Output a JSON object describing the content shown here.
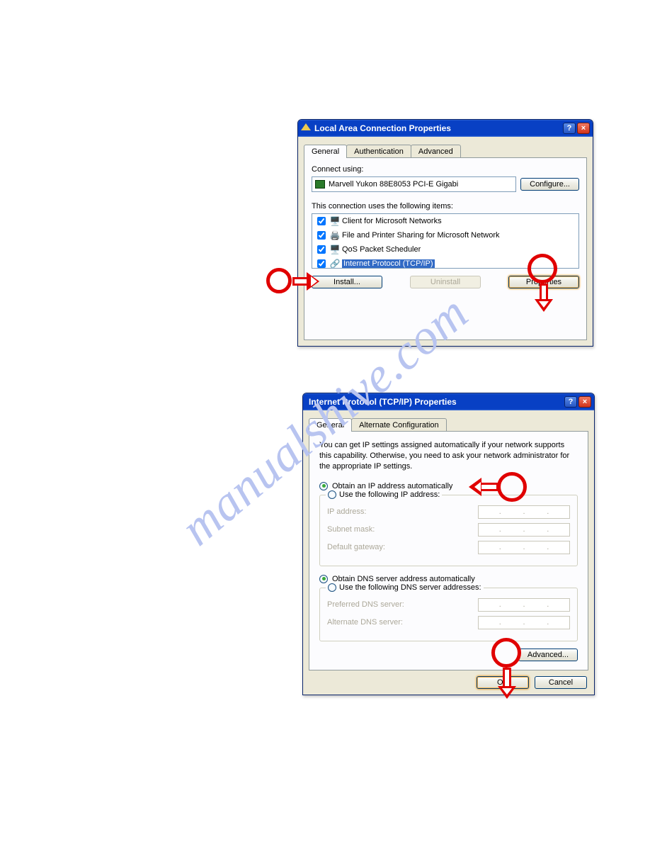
{
  "watermark": "manualshive.com",
  "dialog1": {
    "title": "Local Area Connection Properties",
    "tabs": [
      "General",
      "Authentication",
      "Advanced"
    ],
    "connect_using_label": "Connect using:",
    "adapter": "Marvell Yukon 88E8053 PCI-E Gigabi",
    "configure_btn": "Configure...",
    "items_label": "This connection uses the following items:",
    "items": [
      {
        "label": "Client for Microsoft Networks",
        "checked": true,
        "selected": false
      },
      {
        "label": "File and Printer Sharing for Microsoft Network",
        "checked": true,
        "selected": false
      },
      {
        "label": "QoS Packet Scheduler",
        "checked": true,
        "selected": false
      },
      {
        "label": "Internet Protocol (TCP/IP)",
        "checked": true,
        "selected": true
      }
    ],
    "install_btn": "Install...",
    "uninstall_btn": "Uninstall",
    "properties_btn": "Properties"
  },
  "dialog2": {
    "title": "Internet Protocol (TCP/IP) Properties",
    "tabs": [
      "General",
      "Alternate Configuration"
    ],
    "intro": "You can get IP settings assigned automatically if your network supports this capability. Otherwise, you need to ask your network administrator for the appropriate IP settings.",
    "radio_obtain_ip": "Obtain an IP address automatically",
    "radio_use_ip": "Use the following IP address:",
    "ip_label": "IP address:",
    "subnet_label": "Subnet mask:",
    "gateway_label": "Default gateway:",
    "radio_obtain_dns": "Obtain DNS server address automatically",
    "radio_use_dns": "Use the following DNS server addresses:",
    "pref_dns_label": "Preferred DNS server:",
    "alt_dns_label": "Alternate DNS server:",
    "advanced_btn": "Advanced...",
    "ok_btn": "OK",
    "cancel_btn": "Cancel"
  }
}
